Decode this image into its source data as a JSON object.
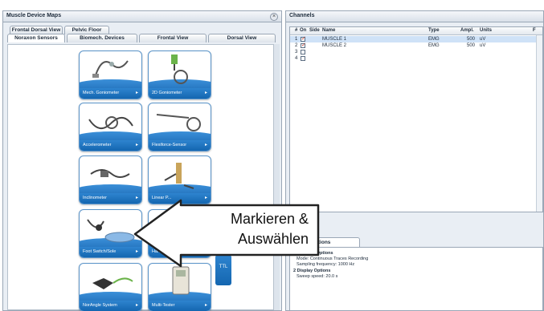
{
  "left_panel": {
    "title": "Muscle Device Maps",
    "close_label": "×",
    "tabs_row1": [
      "Frontal Dorsal View",
      "Pelvic Floor"
    ],
    "tabs_row2": [
      "Noraxon Sensors",
      "Biomech. Devices",
      "Frontal View",
      "Dorsal View"
    ],
    "tiles": [
      {
        "label": "Mech. Goniometer",
        "icon": "goniometer-icon"
      },
      {
        "label": "2D Goniometer",
        "icon": "2d-goniometer-icon"
      },
      {
        "label": "Accelerometer",
        "icon": "accelerometer-icon"
      },
      {
        "label": "Flexiforce-Sensor",
        "icon": "flexiforce-sensor-icon"
      },
      {
        "label": "Inclinometer",
        "icon": "inclinometer-icon"
      },
      {
        "label": "Linear P...",
        "icon": "linear-potentiometer-icon"
      },
      {
        "label": "Foot Switch/Sole",
        "icon": "foot-switch-icon"
      },
      {
        "label": "Ha...",
        "icon": "hand-switch-icon"
      },
      {
        "label": "NorAngle System",
        "icon": "norangle-icon"
      },
      {
        "label": "Multi-Tester",
        "icon": "multi-tester-icon"
      }
    ],
    "ttl_label": "TTL"
  },
  "right_panel": {
    "title": "Channels",
    "columns": [
      "#",
      "On",
      "Side",
      "Name",
      "Type",
      "Ampl.",
      "Units",
      "F"
    ],
    "rows": [
      {
        "num": "1",
        "on": true,
        "side": "",
        "name": "MUSCLE 1",
        "type": "EMG",
        "ampl": "500",
        "units": "uV",
        "selected": true
      },
      {
        "num": "2",
        "on": true,
        "side": "",
        "name": "MUSCLE 2",
        "type": "EMG",
        "ampl": "500",
        "units": "uV",
        "selected": false
      },
      {
        "num": "3",
        "on": false,
        "side": "",
        "name": "",
        "type": "",
        "ampl": "",
        "units": "",
        "selected": false
      },
      {
        "num": "4",
        "on": false,
        "side": "",
        "name": "",
        "type": "",
        "ampl": "",
        "units": "",
        "selected": false
      }
    ],
    "options_tab": "Meas. Options",
    "options": {
      "recording_header": "Recording Options",
      "mode": "Mode: Continuous Traces Recording",
      "sampling": "Sampling frequency: 1000 Hz",
      "display_header": "2 Display Options",
      "sweep": "Sweep speed: 20.0 s"
    }
  },
  "callout": {
    "text_line1": "Markieren &",
    "text_line2": "Auswählen"
  },
  "colors": {
    "tile_blue": "#1c6cb6",
    "selection": "#cfe2f7",
    "panel_bg": "#e9eef4"
  }
}
